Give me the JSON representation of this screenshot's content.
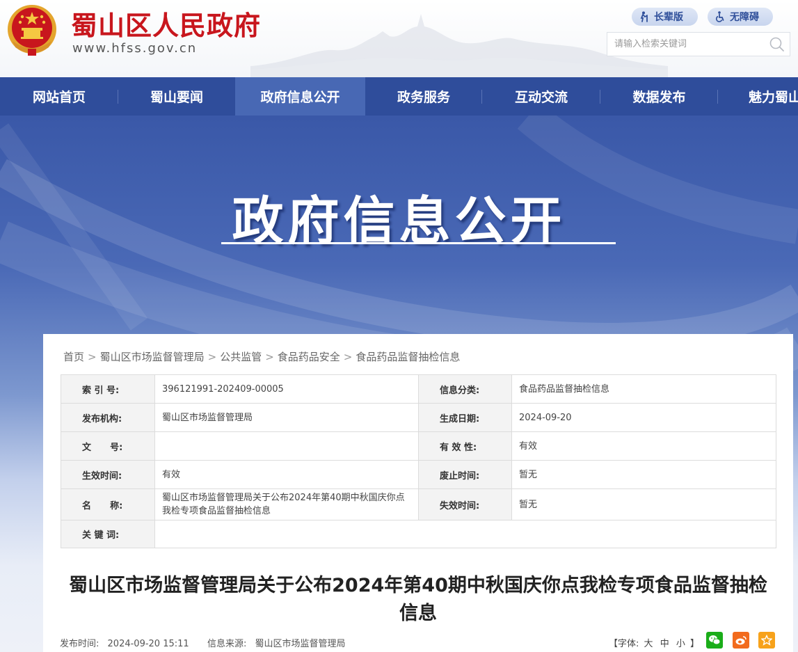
{
  "header": {
    "site_title": "蜀山区人民政府",
    "site_url": "www.hfss.gov.cn",
    "elderly_mode_label": "长辈版",
    "accessibility_label": "无障碍",
    "search_placeholder": "请输入检索关键词"
  },
  "nav": {
    "items": [
      {
        "label": "网站首页"
      },
      {
        "label": "蜀山要闻"
      },
      {
        "label": "政府信息公开",
        "active": true
      },
      {
        "label": "政务服务"
      },
      {
        "label": "互动交流"
      },
      {
        "label": "数据发布"
      },
      {
        "label": "魅力蜀山"
      }
    ]
  },
  "banner": {
    "title": "政府信息公开"
  },
  "breadcrumb": [
    "首页",
    "蜀山区市场监督管理局",
    "公共监管",
    "食品药品安全",
    "食品药品监督抽检信息"
  ],
  "info_table": {
    "index_no_label": "索 引 号:",
    "index_no": "396121991-202409-00005",
    "category_label": "信息分类:",
    "category": "食品药品监督抽检信息",
    "publisher_label": "发布机构:",
    "publisher": "蜀山区市场监督管理局",
    "created_label": "生成日期:",
    "created": "2024-09-20",
    "doc_no_label": "文      号:",
    "doc_no": "",
    "validity_label": "有 效 性:",
    "validity": "有效",
    "effective_label": "生效时间:",
    "effective": "有效",
    "abolished_label": "废止时间:",
    "abolished": "暂无",
    "name_label": "名      称:",
    "name": "蜀山区市场监督管理局关于公布2024年第40期中秋国庆你点我检专项食品监督抽检信息",
    "expire_label": "失效时间:",
    "expire": "暂无",
    "keywords_label": "关 键 词:",
    "keywords": ""
  },
  "article": {
    "title": "蜀山区市场监督管理局关于公布2024年第40期中秋国庆你点我检专项食品监督抽检信息",
    "publish_time_label": "发布时间:",
    "publish_time": "2024-09-20 15:11",
    "source_label": "信息来源:",
    "source": "蜀山区市场监督管理局",
    "font_size_open": "【字体:",
    "font_large": "大",
    "font_medium": "中",
    "font_small": "小",
    "font_size_close": "】"
  },
  "colors": {
    "brand_red": "#c8161d",
    "nav_blue": "#2f4d9b",
    "nav_active": "#4868b4",
    "wechat_green": "#1aad19",
    "weibo_orange": "#f26b1d",
    "favorite_orange": "#f7a21b"
  },
  "icons": [
    "national-emblem-icon",
    "elderly-icon",
    "wheelchair-icon",
    "search-icon",
    "wechat-icon",
    "weibo-icon",
    "favorite-icon"
  ]
}
